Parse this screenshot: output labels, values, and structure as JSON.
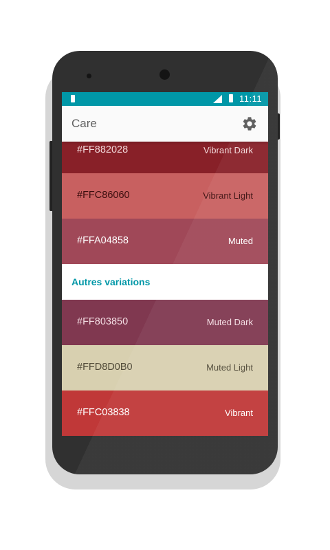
{
  "status_bar": {
    "time": "11:11",
    "color": "#0097a7"
  },
  "app_bar": {
    "title": "Care",
    "settings_icon": "gear-icon"
  },
  "swatches_top": [
    {
      "hex": "#FF882028",
      "label": "Vibrant Dark",
      "bg": "#882028",
      "fg_hex": "#f2d8da",
      "fg_label": "#f2d8da"
    },
    {
      "hex": "#FFC86060",
      "label": "Vibrant Light",
      "bg": "#c86060",
      "fg_hex": "#3a0d0d",
      "fg_label": "#3a0d0d"
    },
    {
      "hex": "#FFA04858",
      "label": "Muted",
      "bg": "#a04858",
      "fg_hex": "#ffffff",
      "fg_label": "#ffffff"
    }
  ],
  "section": {
    "title": "Autres variations"
  },
  "swatches_bottom": [
    {
      "hex": "#FF803850",
      "label": "Muted Dark",
      "bg": "#803850",
      "fg_hex": "#f3dde3",
      "fg_label": "#f3dde3"
    },
    {
      "hex": "#FFD8D0B0",
      "label": "Muted Light",
      "bg": "#d8d0b0",
      "fg_hex": "#504a38",
      "fg_label": "#504a38"
    },
    {
      "hex": "#FFC03838",
      "label": "Vibrant",
      "bg": "#c03838",
      "fg_hex": "#ffffff",
      "fg_label": "#ffffff"
    }
  ]
}
